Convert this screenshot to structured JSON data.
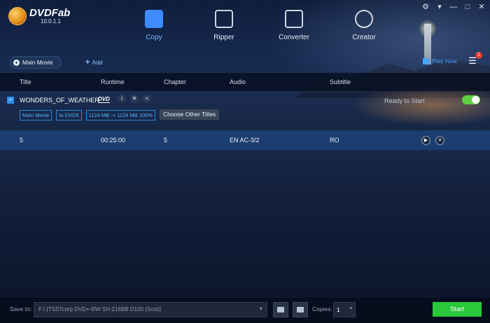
{
  "app": {
    "name": "DVDFab",
    "version": "10.0.1.1"
  },
  "modes": [
    {
      "label": "Copy",
      "icon": "copy-icon",
      "active": true
    },
    {
      "label": "Ripper",
      "icon": "ripper-icon",
      "active": false
    },
    {
      "label": "Converter",
      "icon": "converter-icon",
      "active": false
    },
    {
      "label": "Creator",
      "icon": "creator-icon",
      "active": false
    }
  ],
  "toolbar": {
    "main_movie_label": "Main Movie",
    "add_label": "Add",
    "play_now_label": "Play Now",
    "menu_badge": "1"
  },
  "columns": {
    "title": "Title",
    "runtime": "Runtime",
    "chapter": "Chapter",
    "audio": "Audio",
    "subtitle": "Subtitle"
  },
  "source": {
    "name": "WONDERS_OF_WEATHER",
    "disc_badge": "DVD",
    "status": "Ready to Start",
    "toggle_on": true,
    "tags": [
      "Main Movie",
      "to DVD5",
      "1124 MB -> 1124 MB 100%"
    ],
    "choose_titles_label": "Choose Other Titles"
  },
  "track": {
    "title": "5",
    "runtime": "00:25:00",
    "chapter": "5",
    "audio": "EN  AC-3/2",
    "subtitle": "RO"
  },
  "bottom": {
    "save_to_label": "Save to:",
    "save_to_value": "F:\\ [TSSTcorp DVD+-RW SH-216BB D100 (Scsi)]",
    "copies_label": "Copies:",
    "copies_value": "1",
    "start_label": "Start"
  },
  "colors": {
    "accent": "#3f8cff",
    "start": "#2ac93b",
    "toggle": "#5fcf3f",
    "tag": "#58b2ff",
    "badge": "#e53d2d"
  }
}
